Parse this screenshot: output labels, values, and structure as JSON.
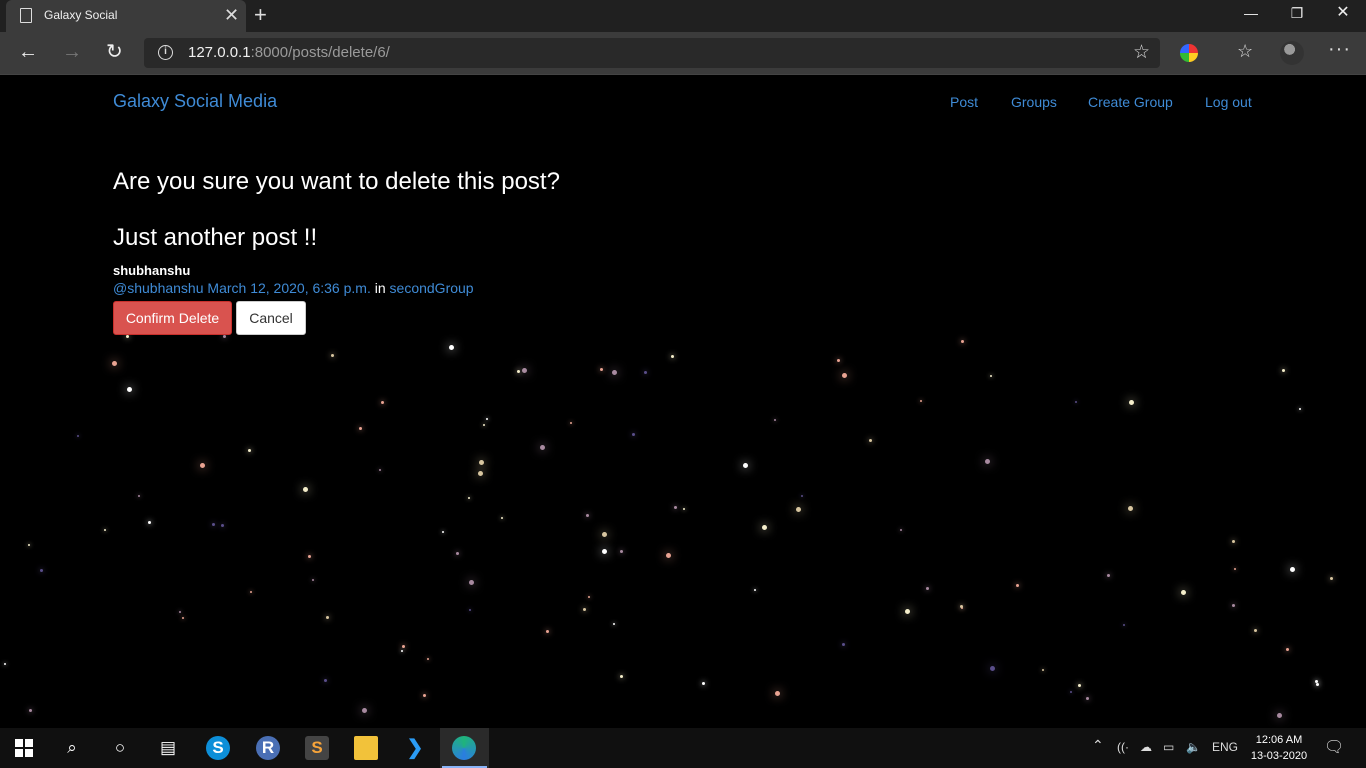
{
  "browser": {
    "tab_title": "Galaxy Social",
    "url_host": "127.0.0.1",
    "url_rest": ":8000/posts/delete/6/"
  },
  "navbar": {
    "brand": "Galaxy Social Media",
    "links": [
      "Post",
      "Groups",
      "Create Group",
      "Log out"
    ]
  },
  "confirm": {
    "heading": "Are you sure you want to delete this post?",
    "post_title": "Just another post !!",
    "author": "shubhanshu",
    "handle": "@shubhanshu",
    "timestamp": "March 12, 2020, 6:36 p.m.",
    "in_label": "in",
    "group": "secondGroup",
    "confirm_label": "Confirm Delete",
    "cancel_label": "Cancel"
  },
  "taskbar": {
    "language": "ENG",
    "time": "12:06 AM",
    "date": "13-03-2020"
  },
  "colors": {
    "link": "#3f8bd6",
    "danger": "#d9534f",
    "background": "#000000"
  }
}
